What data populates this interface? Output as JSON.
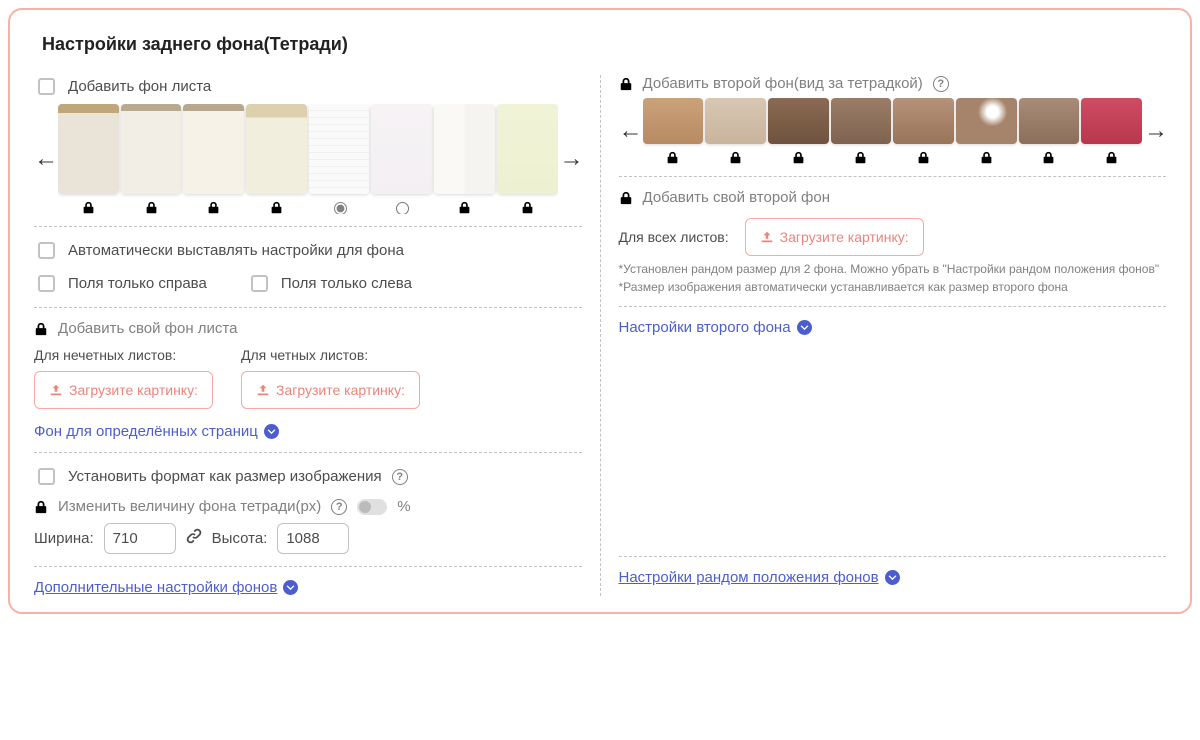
{
  "title": "Настройки заднего фона(Тетради)",
  "left": {
    "add_sheet_bg": "Добавить фон листа",
    "paper_thumbs": [
      {
        "css": "paper-1",
        "locked": true
      },
      {
        "css": "paper-2",
        "locked": true
      },
      {
        "css": "paper-3",
        "locked": true
      },
      {
        "css": "paper-4",
        "locked": true
      },
      {
        "css": "paper-5",
        "locked": false,
        "selected": true
      },
      {
        "css": "paper-6",
        "locked": false,
        "selected": false
      },
      {
        "css": "paper-7",
        "locked": true
      },
      {
        "css": "paper-8",
        "locked": true
      }
    ],
    "auto_settings": "Автоматически выставлять настройки для фона",
    "margins_right": "Поля только справа",
    "margins_left": "Поля только слева",
    "add_own_sheet_bg": "Добавить свой фон листа",
    "odd_label": "Для нечетных листов:",
    "even_label": "Для четных листов:",
    "upload_label": "Загрузите картинку:",
    "bg_for_pages": "Фон для определённых страниц",
    "set_format_as_image": "Установить формат как размер изображения",
    "change_bg_size": "Изменить величину фона тетради(px)",
    "percent": "%",
    "width_label": "Ширина:",
    "height_label": "Высота:",
    "width_value": "710",
    "height_value": "1088",
    "more_bg_settings": "Дополнительные настройки фонов"
  },
  "right": {
    "add_second_bg": "Добавить второй фон(вид за тетрадкой)",
    "desk_thumbs": [
      {
        "css": "wood-1"
      },
      {
        "css": "wood-2"
      },
      {
        "css": "wood-3"
      },
      {
        "css": "wood-4"
      },
      {
        "css": "wood-5"
      },
      {
        "css": "wood-6"
      },
      {
        "css": "wood-7"
      },
      {
        "css": "wood-8"
      }
    ],
    "add_own_second_bg": "Добавить свой второй фон",
    "all_sheets_label": "Для всех листов:",
    "upload_label": "Загрузите картинку:",
    "hint1": "*Установлен рандом размер для 2 фона. Можно убрать в \"Настройки рандом положения фонов\"",
    "hint2": "*Размер изображения автоматически устанавливается как размер второго фона",
    "second_bg_settings": "Настройки второго фона",
    "random_pos_settings": "Настройки рандом положения фонов"
  }
}
